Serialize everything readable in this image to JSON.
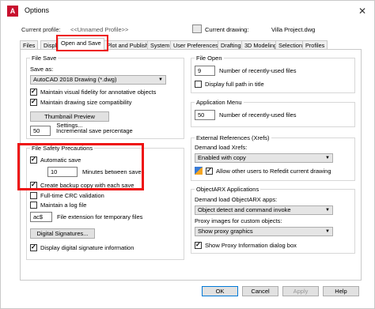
{
  "window": {
    "title": "Options",
    "app_icon": "A"
  },
  "header": {
    "current_profile_label": "Current profile:",
    "current_profile_value": "<<Unnamed Profile>>",
    "current_drawing_label": "Current drawing:",
    "current_drawing_value": "Villa Project.dwg"
  },
  "tabs": [
    "Files",
    "Display",
    "Open and Save",
    "Plot and Publish",
    "System",
    "User Preferences",
    "Drafting",
    "3D Modeling",
    "Selection",
    "Profiles"
  ],
  "file_save": {
    "title": "File Save",
    "save_as_label": "Save as:",
    "save_as_value": "AutoCAD 2018 Drawing (*.dwg)",
    "maintain_visual": "Maintain visual fidelity for annotative objects",
    "maintain_drawing_size": "Maintain drawing size compatibility",
    "thumbnail_button": "Thumbnail Preview Settings...",
    "incremental_value": "50",
    "incremental_label": "Incremental save percentage"
  },
  "file_safety": {
    "title": "File Safety Precautions",
    "automatic_save": "Automatic save",
    "minutes_value": "10",
    "minutes_label": "Minutes between saves",
    "create_backup": "Create backup copy with each save",
    "full_time_crc": "Full-time CRC validation",
    "maintain_log": "Maintain a log file",
    "temp_ext_value": "ac$",
    "temp_ext_label": "File extension for temporary files",
    "digital_signatures_button": "Digital Signatures...",
    "display_signature": "Display digital signature information"
  },
  "file_open": {
    "title": "File Open",
    "recent_value": "9",
    "recent_label": "Number of recently-used files",
    "display_full_path": "Display full path in title"
  },
  "application_menu": {
    "title": "Application Menu",
    "recent_value": "50",
    "recent_label": "Number of recently-used files"
  },
  "xrefs": {
    "title": "External References (Xrefs)",
    "demand_load_label": "Demand load Xrefs:",
    "demand_load_value": "Enabled with copy",
    "allow_others": "Allow other users to Refedit current drawing"
  },
  "objectarx": {
    "title": "ObjectARX Applications",
    "demand_load_label": "Demand load ObjectARX apps:",
    "demand_load_value": "Object detect and command invoke",
    "proxy_label": "Proxy images for custom objects:",
    "proxy_value": "Show proxy graphics",
    "show_proxy_dialog": "Show Proxy Information dialog box"
  },
  "footer": {
    "ok": "OK",
    "cancel": "Cancel",
    "apply": "Apply",
    "help": "Help"
  },
  "colors": {
    "highlight": "#e11111",
    "accent": "#0078d7"
  }
}
